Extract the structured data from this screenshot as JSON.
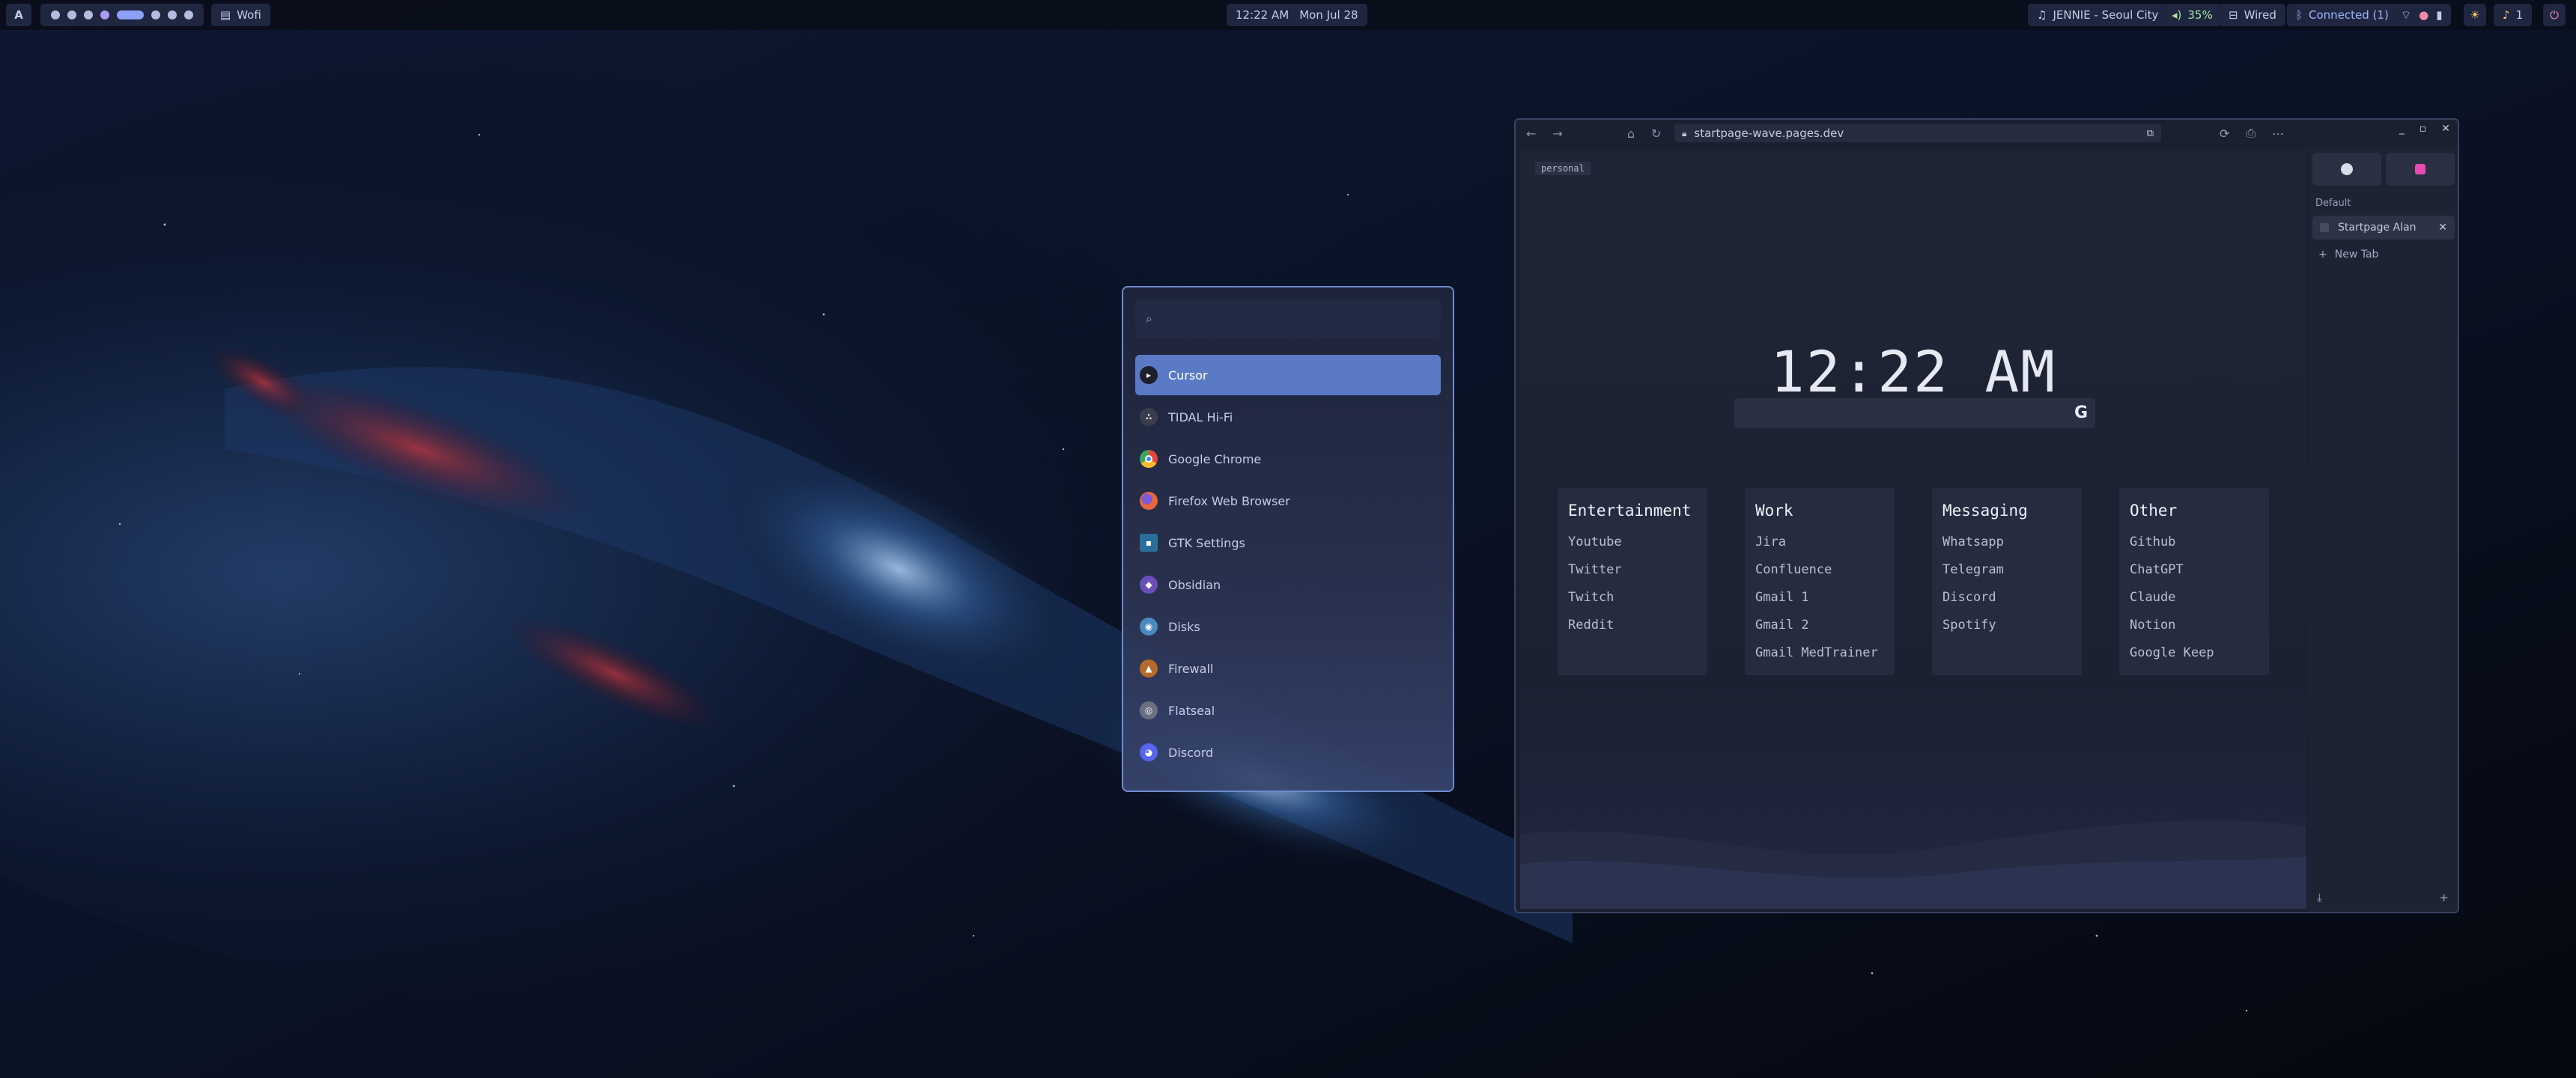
{
  "topbar": {
    "launcher_logo": "A",
    "window_label": "Wofi",
    "clock": "12:22 AM",
    "date": "Mon Jul 28",
    "media": "JENNIE - Seoul City",
    "volume": "35%",
    "network": "Wired",
    "bluetooth": "Connected (1)",
    "notifications": "1"
  },
  "launcher": {
    "search_placeholder": "",
    "apps": [
      {
        "label": "Cursor",
        "icon": "cursor-icon",
        "color": "#1d1f2a",
        "glyph": "▸",
        "selected": true
      },
      {
        "label": "TIDAL Hi-Fi",
        "icon": "tidal-icon",
        "color": "#3a3e4a",
        "glyph": "∴",
        "selected": false
      },
      {
        "label": "Google Chrome",
        "icon": "chrome-icon",
        "color": "#3f8de0",
        "glyph": "●",
        "selected": false
      },
      {
        "label": "Firefox Web Browser",
        "icon": "firefox-icon",
        "color": "#c85a3a",
        "glyph": "●",
        "selected": false
      },
      {
        "label": "GTK Settings",
        "icon": "gtk-settings-icon",
        "color": "#2a6f9a",
        "glyph": "■",
        "selected": false
      },
      {
        "label": "Obsidian",
        "icon": "obsidian-icon",
        "color": "#6b4fb8",
        "glyph": "◆",
        "selected": false
      },
      {
        "label": "Disks",
        "icon": "disks-icon",
        "color": "#4a8ac0",
        "glyph": "◉",
        "selected": false
      },
      {
        "label": "Firewall",
        "icon": "firewall-icon",
        "color": "#b86a2a",
        "glyph": "▲",
        "selected": false
      },
      {
        "label": "Flatseal",
        "icon": "flatseal-icon",
        "color": "#6a7080",
        "glyph": "◎",
        "selected": false
      },
      {
        "label": "Discord",
        "icon": "discord-icon",
        "color": "#5865f2",
        "glyph": "◕",
        "selected": false
      }
    ]
  },
  "browser": {
    "url": "startpage-wave.pages.dev",
    "page": {
      "profile_tag": "personal",
      "clock": "12:22 AM",
      "search_glyph": "G",
      "cards": [
        {
          "title": "Entertainment",
          "links": [
            "Youtube",
            "Twitter",
            "Twitch",
            "Reddit"
          ]
        },
        {
          "title": "Work",
          "links": [
            "Jira",
            "Confluence",
            "Gmail 1",
            "Gmail 2",
            "Gmail MedTrainer"
          ]
        },
        {
          "title": "Messaging",
          "links": [
            "Whatsapp",
            "Telegram",
            "Discord",
            "Spotify"
          ]
        },
        {
          "title": "Other",
          "links": [
            "Github",
            "ChatGPT",
            "Claude",
            "Notion",
            "Google Keep"
          ]
        }
      ]
    },
    "sidebar": {
      "section": "Default",
      "tab_label": "Startpage Alan",
      "new_tab": "New Tab"
    }
  },
  "colors": {
    "accent": "#5b7ac6",
    "launcher_border": "#6f8bcf",
    "bar_bg": "#0a0e1a",
    "pill_bg": "#1f2740"
  }
}
